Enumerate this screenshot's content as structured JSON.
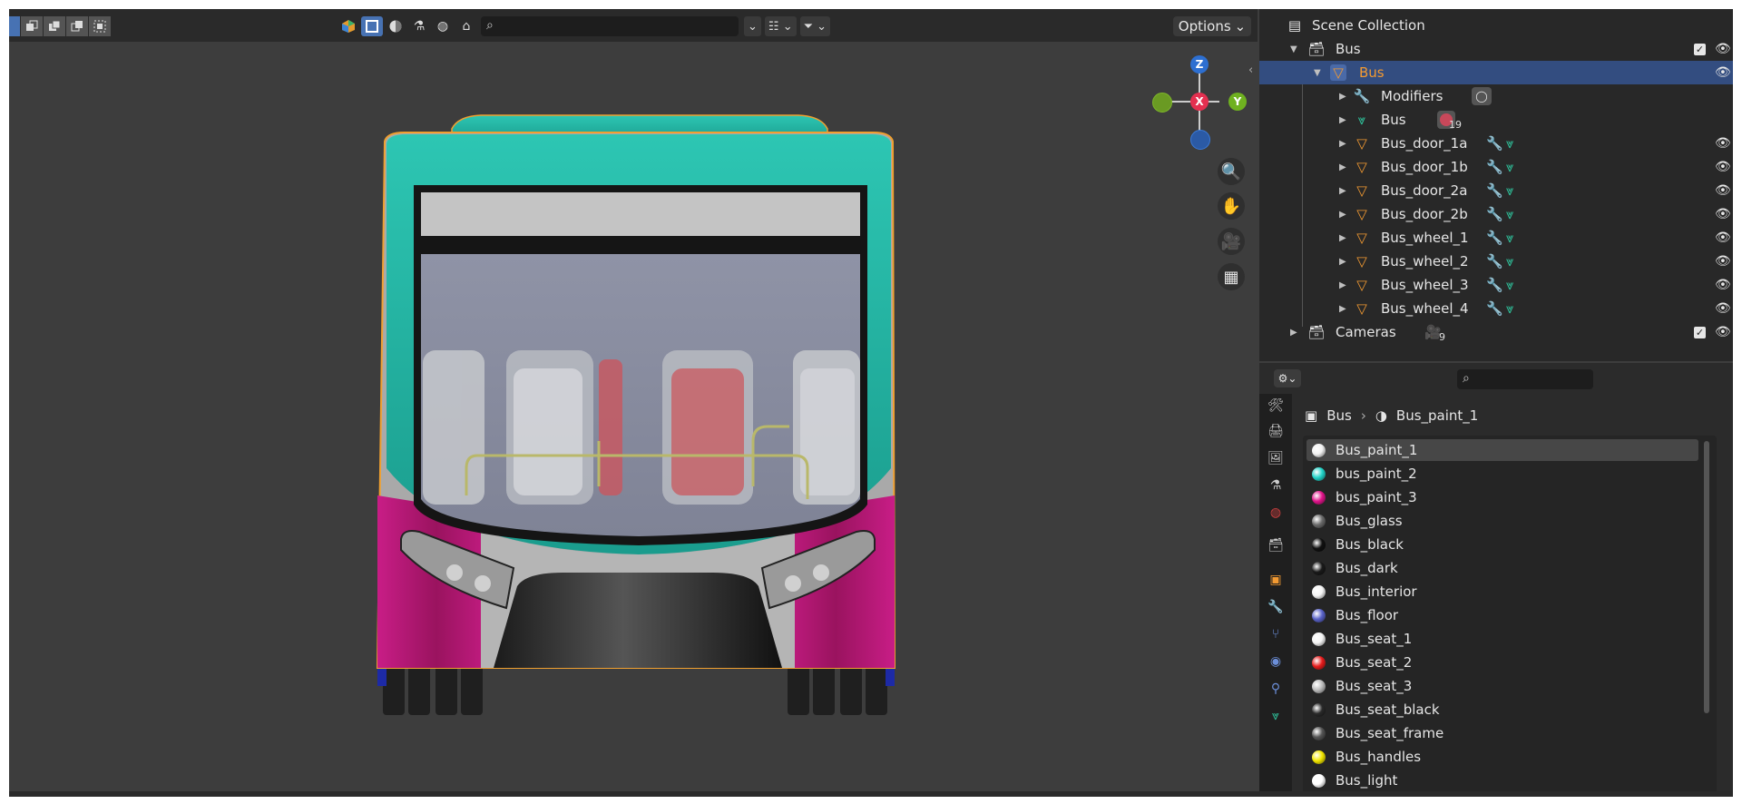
{
  "viewport": {
    "header": {
      "options_label": "Options"
    },
    "gizmo": {
      "x": "X",
      "y": "Y",
      "z": "Z"
    },
    "nav": [
      "zoom-icon",
      "hand-icon",
      "camera-icon",
      "grid-icon"
    ]
  },
  "outliner": {
    "rows": [
      {
        "label": "Scene Collection",
        "icon": "scene-collection-icon",
        "level": 0
      },
      {
        "label": "Bus",
        "icon": "collection-icon",
        "level": 1,
        "expanded": true,
        "checkbox": true,
        "eye": true
      },
      {
        "label": "Bus",
        "icon": "mesh-object-icon",
        "level": 2,
        "expanded": true,
        "selected": true,
        "eye": true
      },
      {
        "label": "Modifiers",
        "icon": "wrench-icon",
        "level": 3
      },
      {
        "label": "Bus",
        "icon": "mesh-data-icon",
        "level": 3,
        "material_count": "19"
      },
      {
        "label": "Bus_door_1a",
        "icon": "mesh-object-icon",
        "level": 3,
        "eye": true
      },
      {
        "label": "Bus_door_1b",
        "icon": "mesh-object-icon",
        "level": 3,
        "eye": true
      },
      {
        "label": "Bus_door_2a",
        "icon": "mesh-object-icon",
        "level": 3,
        "eye": true
      },
      {
        "label": "Bus_door_2b",
        "icon": "mesh-object-icon",
        "level": 3,
        "eye": true
      },
      {
        "label": "Bus_wheel_1",
        "icon": "mesh-object-icon",
        "level": 3,
        "eye": true
      },
      {
        "label": "Bus_wheel_2",
        "icon": "mesh-object-icon",
        "level": 3,
        "eye": true
      },
      {
        "label": "Bus_wheel_3",
        "icon": "mesh-object-icon",
        "level": 3,
        "eye": true
      },
      {
        "label": "Bus_wheel_4",
        "icon": "mesh-object-icon",
        "level": 3,
        "eye": true
      },
      {
        "label": "Cameras",
        "icon": "collection-icon",
        "level": 1,
        "checkbox": true,
        "eye": true,
        "camera_count": "9"
      }
    ]
  },
  "properties": {
    "breadcrumb": {
      "object": "Bus",
      "material": "Bus_paint_1"
    },
    "materials": [
      {
        "name": "Bus_paint_1",
        "color": "#f2f2f2",
        "active": true
      },
      {
        "name": "bus_paint_2",
        "color": "#22d3c8"
      },
      {
        "name": "bus_paint_3",
        "color": "#e0148a"
      },
      {
        "name": "Bus_glass",
        "color": "#6a6a6a"
      },
      {
        "name": "Bus_black",
        "color": "#111111"
      },
      {
        "name": "Bus_dark",
        "color": "#1a1a1a"
      },
      {
        "name": "Bus_interior",
        "color": "#f5f5f5"
      },
      {
        "name": "Bus_floor",
        "color": "#5a63c8"
      },
      {
        "name": "Bus_seat_1",
        "color": "#f5f5f5"
      },
      {
        "name": "Bus_seat_2",
        "color": "#e61c1c"
      },
      {
        "name": "Bus_seat_3",
        "color": "#bdbdbd"
      },
      {
        "name": "Bus_seat_black",
        "color": "#2a2a2a"
      },
      {
        "name": "Bus_seat_frame",
        "color": "#555555"
      },
      {
        "name": "Bus_handles",
        "color": "#f2e600"
      },
      {
        "name": "Bus_light",
        "color": "#ffffff"
      }
    ]
  },
  "colors": {
    "selection_outline": "#f0a030",
    "teal": "#21b3a2",
    "magenta": "#b0186f",
    "outliner_selected": "#334d80"
  }
}
